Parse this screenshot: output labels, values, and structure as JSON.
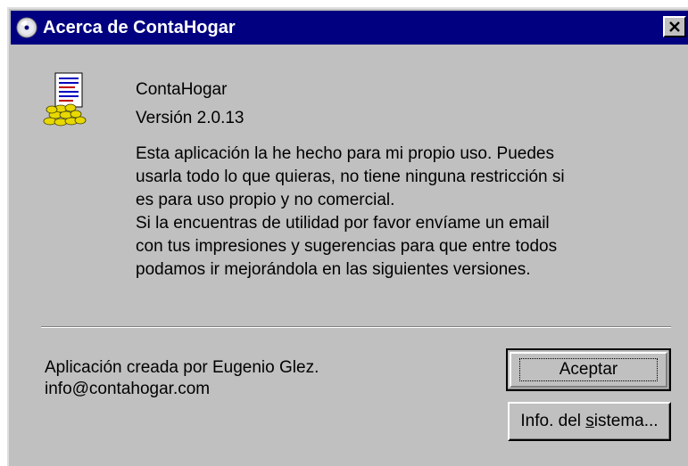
{
  "window": {
    "title": "Acerca de ContaHogar",
    "title_icon": "cd-disc-icon",
    "close_icon": "close-x-icon"
  },
  "product": {
    "icon": "ledger-coins-icon",
    "name": "ContaHogar",
    "version": "Versión 2.0.13"
  },
  "description": {
    "lines": [
      "Esta aplicación la he hecho para mi propio uso. Puedes",
      "usarla todo lo que quieras, no tiene ninguna restricción si",
      "es para uso propio y no comercial.",
      "Si la encuentras de utilidad por favor envíame un email",
      "con tus impresiones y sugerencias para que entre todos",
      "podamos ir mejorándola en las siguientes versiones."
    ]
  },
  "footer": {
    "credits": "Aplicación creada por Eugenio Glez.",
    "email": "info@contahogar.com"
  },
  "buttons": {
    "ok_label": "Aceptar",
    "info_label_pre": "Info. del ",
    "info_label_accel": "s",
    "info_label_post": "istema..."
  },
  "colors": {
    "titlebar": "#000080",
    "dialog_bg": "#c0c0c0"
  }
}
